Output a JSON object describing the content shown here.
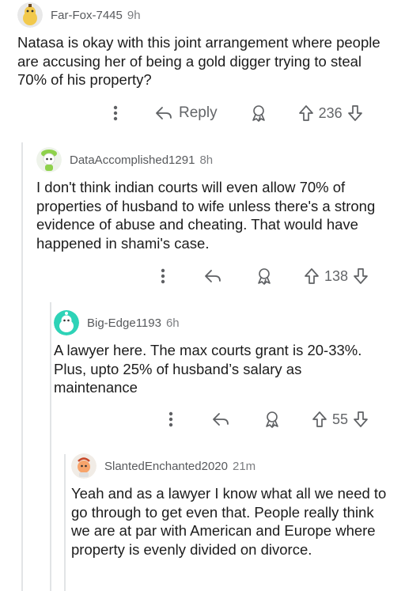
{
  "comments": [
    {
      "username": "Far-Fox-7445",
      "time": "9h",
      "body": "Natasa is okay with this joint arrangement where people are accusing her of being a gold digger trying to steal 70% of his property?",
      "reply_label": "Reply",
      "votes": "236",
      "avatar_color": "#f2c94c"
    },
    {
      "username": "DataAccomplished1291",
      "time": "8h",
      "body": "I don't think indian courts will even allow 70% of properties of husband to wife unless there's a strong evidence of abuse and cheating. That would have happened in shami's case.",
      "votes": "138",
      "avatar_color": "#8ed14b"
    },
    {
      "username": "Big-Edge1193",
      "time": "6h",
      "body": "A lawyer here. The max courts grant is 20-33%. Plus, upto 25% of husband’s salary as maintenance",
      "votes": "55",
      "avatar_color": "#2ed3b7"
    },
    {
      "username": "SlantedEnchanted2020",
      "time": "21m",
      "body": "Yeah and as a lawyer I know what all we need to go through to get even that. People really think we are at par with American and Europe where property is evenly divided on divorce.",
      "avatar_color": "#f7a46b"
    }
  ]
}
